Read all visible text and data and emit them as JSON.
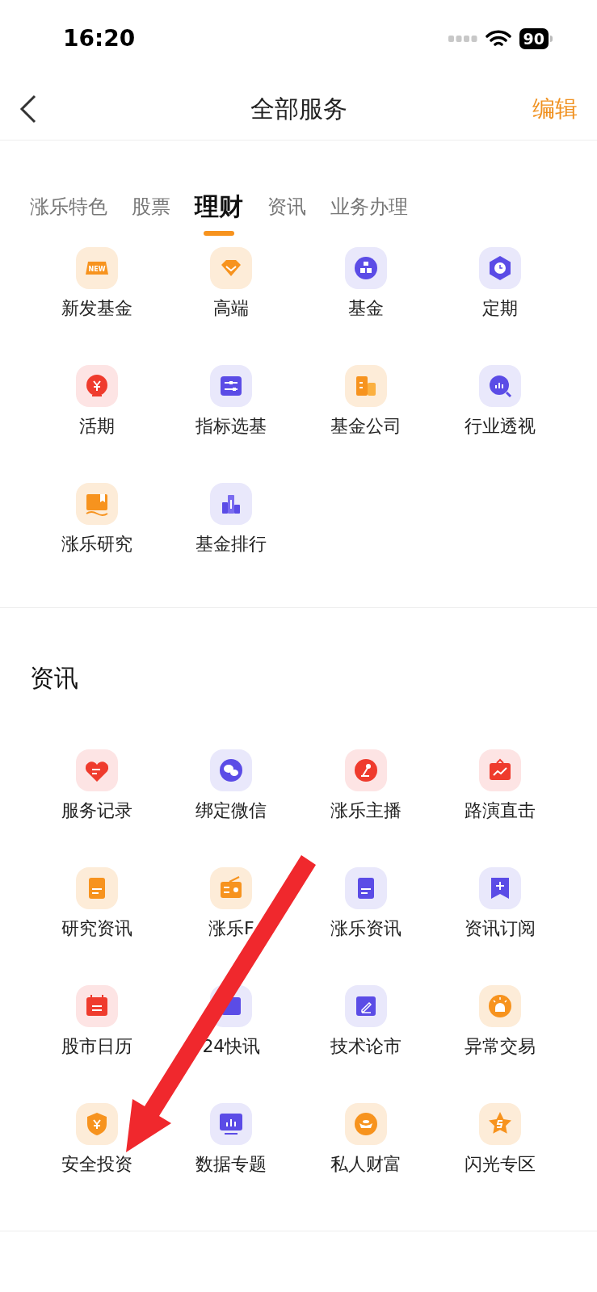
{
  "status_bar": {
    "time": "16:20",
    "battery": "90"
  },
  "nav": {
    "title": "全部服务",
    "action": "编辑"
  },
  "tabs": [
    {
      "label": "涨乐特色",
      "selected": false
    },
    {
      "label": "股票",
      "selected": false
    },
    {
      "label": "理财",
      "selected": true
    },
    {
      "label": "资讯",
      "selected": false
    },
    {
      "label": "业务办理",
      "selected": false
    }
  ],
  "sections": [
    {
      "items": [
        {
          "label": "新发基金",
          "icon_text": "NEW"
        },
        {
          "label": "高端"
        },
        {
          "label": "基金"
        },
        {
          "label": "定期"
        },
        {
          "label": "活期"
        },
        {
          "label": "指标选基"
        },
        {
          "label": "基金公司"
        },
        {
          "label": "行业透视"
        },
        {
          "label": "涨乐研究"
        },
        {
          "label": "基金排行"
        }
      ]
    },
    {
      "title": "资讯",
      "items": [
        {
          "label": "服务记录"
        },
        {
          "label": "绑定微信"
        },
        {
          "label": "涨乐主播"
        },
        {
          "label": "路演直击"
        },
        {
          "label": "研究资讯"
        },
        {
          "label": "涨乐F"
        },
        {
          "label": "涨乐资讯"
        },
        {
          "label": "资讯订阅"
        },
        {
          "label": "股市日历"
        },
        {
          "label": "24快讯"
        },
        {
          "label": "技术论市"
        },
        {
          "label": "异常交易"
        },
        {
          "label": "安全投资"
        },
        {
          "label": "数据专题"
        },
        {
          "label": "私人财富"
        },
        {
          "label": "闪光专区"
        }
      ]
    }
  ]
}
